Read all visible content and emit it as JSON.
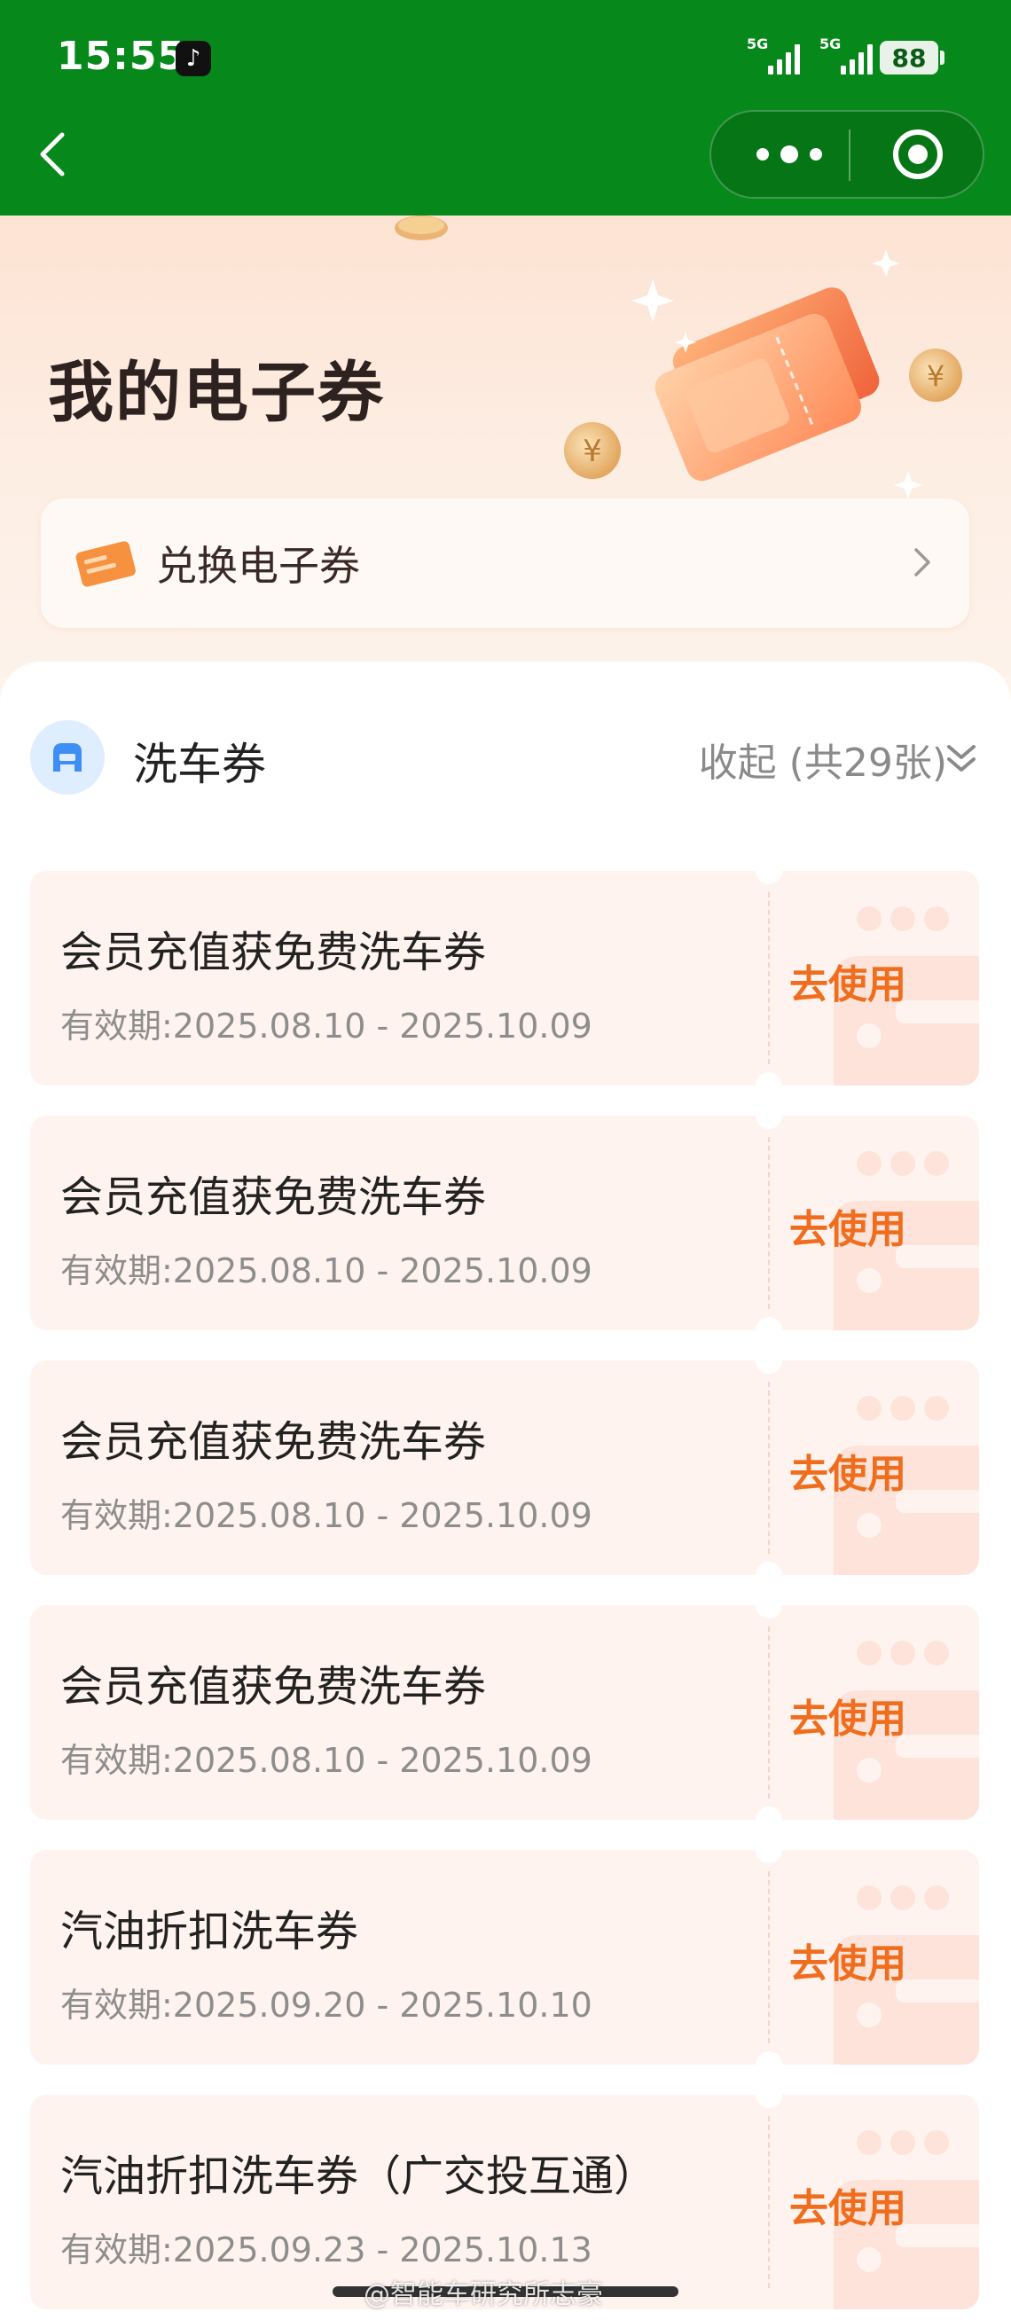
{
  "status_bar": {
    "time": "15:55",
    "tiktok_glyph": "♪",
    "signal1_label": "5G",
    "signal2_label": "5G",
    "battery": "88"
  },
  "hero": {
    "title": "我的电子券",
    "redeem_label": "兑换电子券"
  },
  "category": {
    "title": "洗车券",
    "collapse_label": "收起 (共29张)"
  },
  "coupons": [
    {
      "name": "会员充值获免费洗车券",
      "validity": "有效期:2025.08.10 - 2025.10.09",
      "action": "去使用"
    },
    {
      "name": "会员充值获免费洗车券",
      "validity": "有效期:2025.08.10 - 2025.10.09",
      "action": "去使用"
    },
    {
      "name": "会员充值获免费洗车券",
      "validity": "有效期:2025.08.10 - 2025.10.09",
      "action": "去使用"
    },
    {
      "name": "会员充值获免费洗车券",
      "validity": "有效期:2025.08.10 - 2025.10.09",
      "action": "去使用"
    },
    {
      "name": "汽油折扣洗车券",
      "validity": "有效期:2025.09.20 - 2025.10.10",
      "action": "去使用"
    },
    {
      "name": "汽油折扣洗车券（广交投互通）",
      "validity": "有效期:2025.09.23 - 2025.10.13",
      "action": "去使用"
    }
  ],
  "watermark": "@智能车研究所志豪",
  "colors": {
    "header_green": "#07881a",
    "action_orange": "#ef6d1c",
    "card_bg": "#fff3ef"
  }
}
